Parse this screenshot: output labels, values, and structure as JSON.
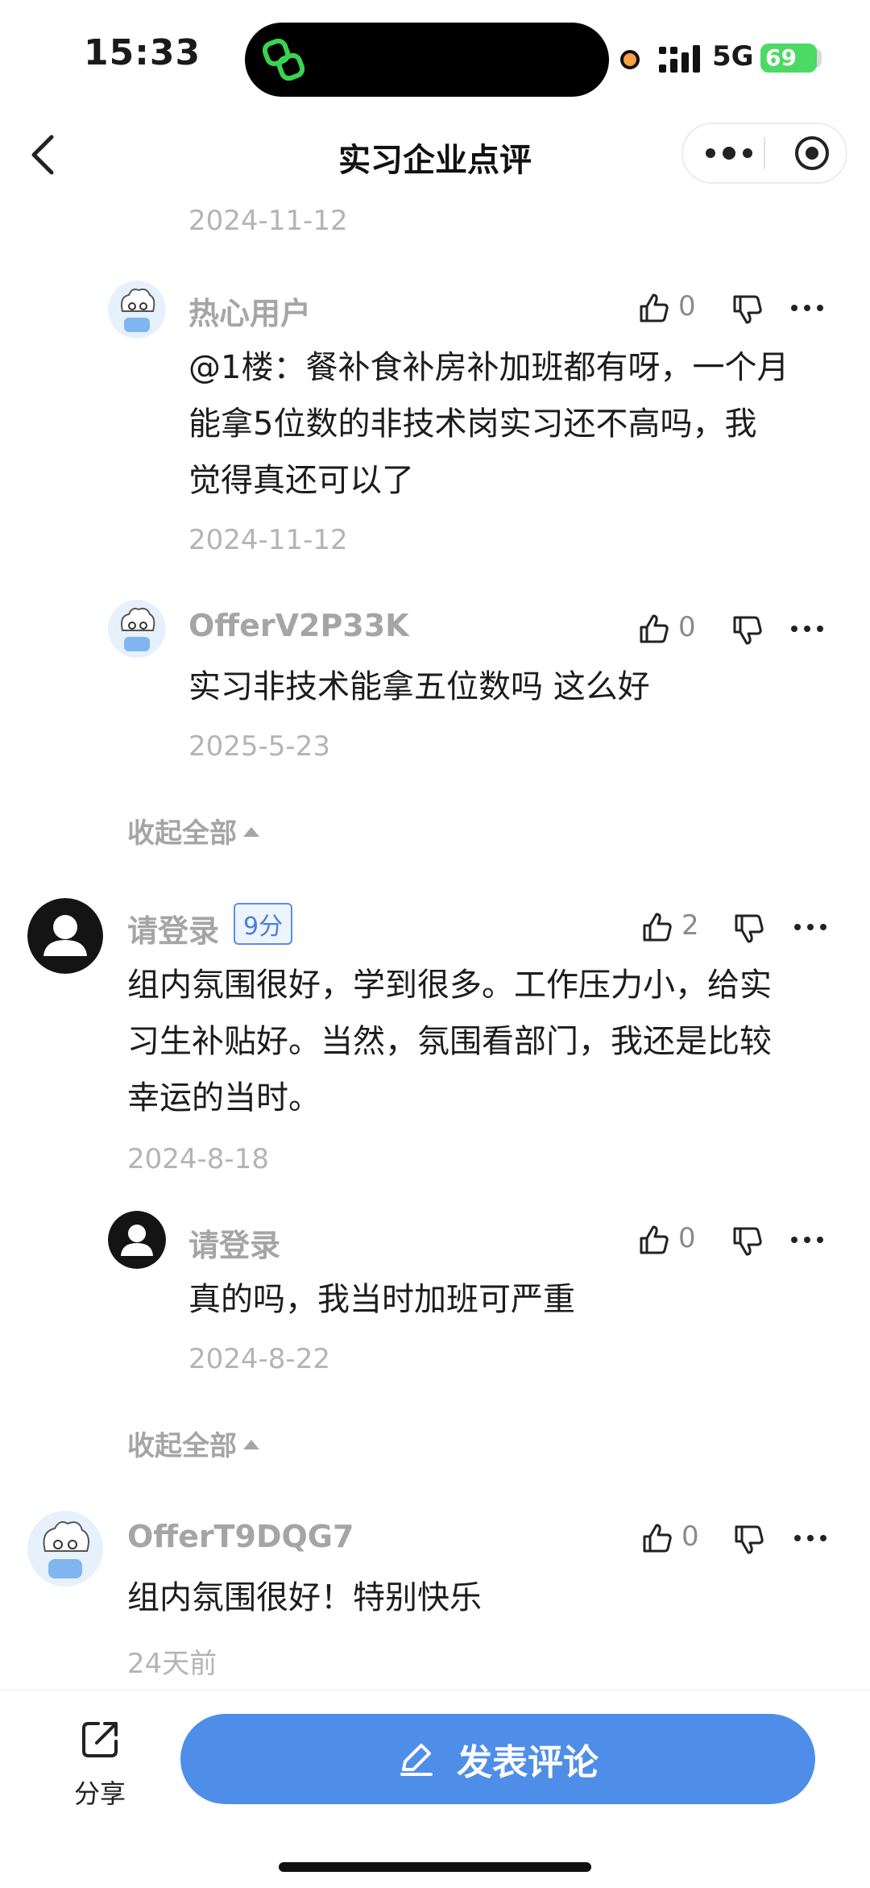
{
  "status_bar": {
    "time": "15:33",
    "network": "5G",
    "battery": "69"
  },
  "nav": {
    "title": "实习企业点评"
  },
  "top_date": "2024-11-12",
  "comments": [
    {
      "user": "热心用户",
      "avatar": "cartoon-avatar",
      "likes": "0",
      "text_lines": [
        "@1楼：餐补食补房补加班都有呀，一个月",
        "能拿5位数的非技术岗实习还不高吗，我",
        "觉得真还可以了"
      ],
      "date": "2024-11-12"
    },
    {
      "user": "OfferV2P33K",
      "avatar": "cartoon-avatar",
      "likes": "0",
      "text_lines": [
        "实习非技术能拿五位数吗 这么好"
      ],
      "date": "2025-5-23"
    },
    {
      "user": "请登录",
      "avatar": "default-person-avatar",
      "score": "9分",
      "likes": "2",
      "text_lines": [
        "组内氛围很好，学到很多。工作压力小，给实",
        "习生补贴好。当然，氛围看部门，我还是比较",
        "幸运的当时。"
      ],
      "date": "2024-8-18"
    },
    {
      "user": "请登录",
      "avatar": "default-person-avatar",
      "likes": "0",
      "text_lines": [
        "真的吗，我当时加班可严重"
      ],
      "date": "2024-8-22"
    },
    {
      "user": "OfferT9DQG7",
      "avatar": "cartoon-avatar",
      "likes": "0",
      "text_lines": [
        "组内氛围很好！特别快乐"
      ],
      "date": "24天前"
    }
  ],
  "collapse_label": "收起全部",
  "bottom": {
    "share_label": "分享",
    "post_label": "发表评论"
  },
  "colors": {
    "accent": "#4f8ee8",
    "muted": "#a5a5a5"
  }
}
